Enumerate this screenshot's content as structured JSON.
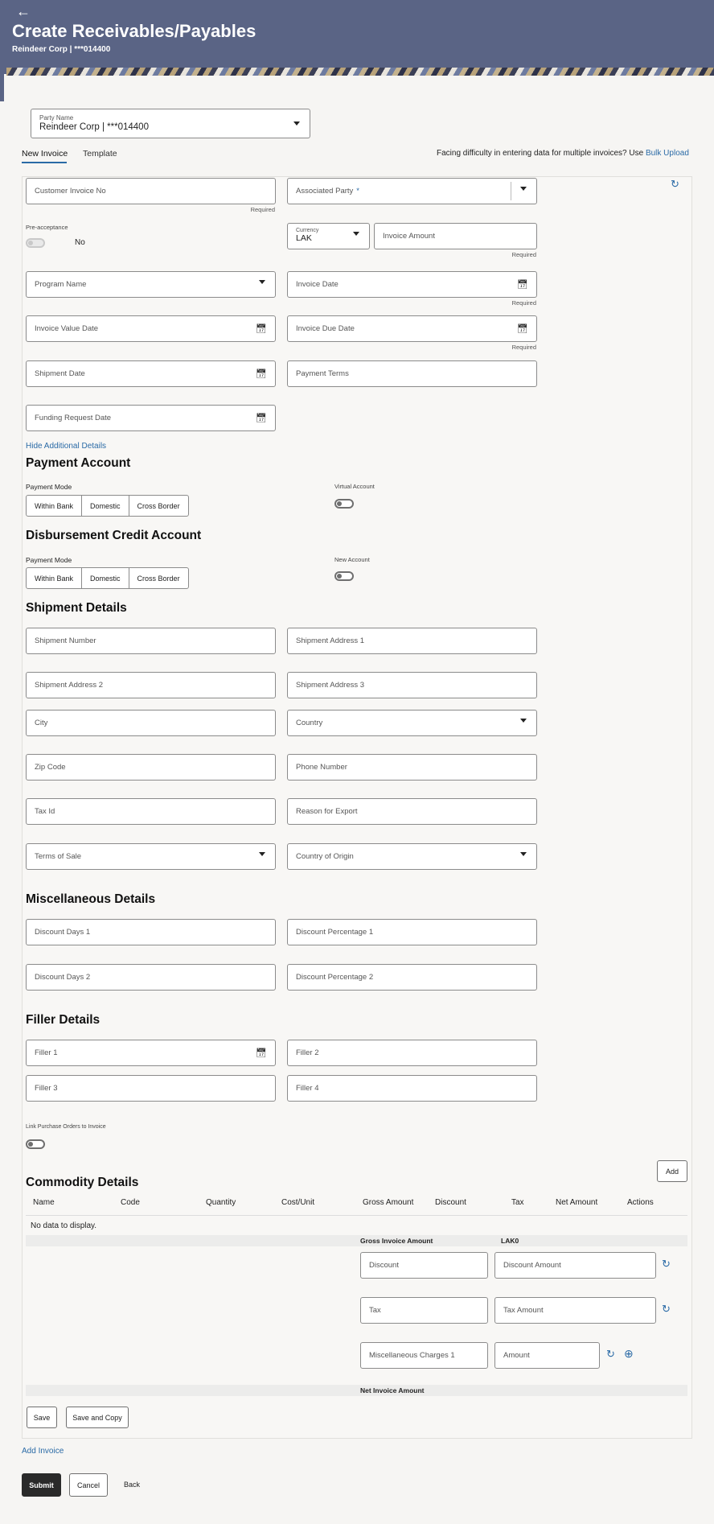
{
  "header": {
    "back_icon": "back-arrow-icon",
    "title": "Create Receivables/Payables",
    "subtitle": "Reindeer Corp | ***014400"
  },
  "party": {
    "label": "Party Name",
    "value": "Reindeer Corp | ***014400"
  },
  "tabs": {
    "new_invoice": "New Invoice",
    "template": "Template"
  },
  "bulk": {
    "text": "Facing difficulty in entering data for multiple invoices? Use",
    "link": "Bulk Upload"
  },
  "invoice": {
    "customer_invoice_no": "Customer Invoice No",
    "associated_party": "Associated Party",
    "required": "Required",
    "pre_acceptance_label": "Pre-acceptance",
    "pre_acceptance_value": "No",
    "currency_label": "Currency",
    "currency_value": "LAK",
    "invoice_amount": "Invoice Amount",
    "program_name": "Program Name",
    "invoice_date": "Invoice Date",
    "invoice_value_date": "Invoice Value Date",
    "invoice_due_date": "Invoice Due Date",
    "shipment_date": "Shipment Date",
    "payment_terms": "Payment Terms",
    "funding_request_date": "Funding Request Date",
    "hide_additional": "Hide Additional Details"
  },
  "payment_account": {
    "title": "Payment Account",
    "mode_label": "Payment Mode",
    "modes": [
      "Within Bank",
      "Domestic",
      "Cross Border"
    ],
    "virtual_label": "Virtual Account"
  },
  "disbursement": {
    "title": "Disbursement Credit Account",
    "mode_label": "Payment Mode",
    "modes": [
      "Within Bank",
      "Domestic",
      "Cross Border"
    ],
    "new_label": "New Account"
  },
  "shipment": {
    "title": "Shipment Details",
    "number": "Shipment Number",
    "address1": "Shipment Address 1",
    "address2": "Shipment Address 2",
    "address3": "Shipment Address 3",
    "city": "City",
    "country": "Country",
    "zip": "Zip Code",
    "phone": "Phone Number",
    "tax_id": "Tax Id",
    "reason": "Reason for Export",
    "terms_of_sale": "Terms of Sale",
    "country_of_origin": "Country of Origin"
  },
  "misc": {
    "title": "Miscellaneous Details",
    "discount_days_1": "Discount Days 1",
    "discount_pct_1": "Discount Percentage 1",
    "discount_days_2": "Discount Days 2",
    "discount_pct_2": "Discount Percentage 2"
  },
  "filler": {
    "title": "Filler Details",
    "filler1": "Filler 1",
    "filler2": "Filler 2",
    "filler3": "Filler 3",
    "filler4": "Filler 4"
  },
  "link_po": {
    "label": "Link Purchase Orders to Invoice"
  },
  "commodity": {
    "title": "Commodity Details",
    "add": "Add",
    "columns": [
      "Name",
      "Code",
      "Quantity",
      "Cost/Unit",
      "Gross Amount",
      "Discount",
      "Tax",
      "Net Amount",
      "Actions"
    ],
    "empty": "No data to display.",
    "gross_label": "Gross Invoice Amount",
    "gross_value": "LAK0",
    "discount": "Discount",
    "discount_amount": "Discount Amount",
    "tax": "Tax",
    "tax_amount": "Tax Amount",
    "misc_charges": "Miscellaneous Charges 1",
    "amount": "Amount",
    "net_label": "Net Invoice Amount"
  },
  "card_buttons": {
    "save": "Save",
    "save_copy": "Save and Copy"
  },
  "add_invoice": "Add Invoice",
  "footer": {
    "submit": "Submit",
    "cancel": "Cancel",
    "back": "Back"
  }
}
